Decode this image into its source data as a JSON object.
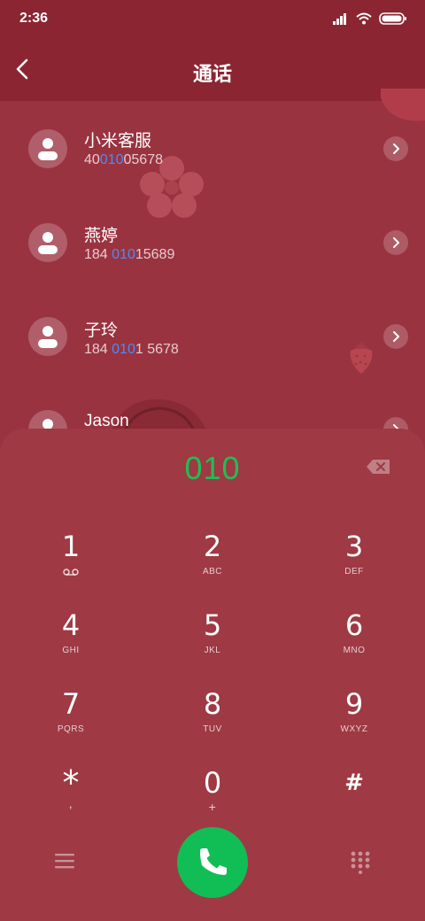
{
  "status": {
    "time": "2:36"
  },
  "header": {
    "title": "通话"
  },
  "contacts": [
    {
      "name": "小米客服",
      "num_pre": "40",
      "num_hl": "010",
      "num_post": "05678"
    },
    {
      "name": "燕婷",
      "num_pre": "184 ",
      "num_hl": "010",
      "num_post": "15689"
    },
    {
      "name": "子玲",
      "num_pre": "184 ",
      "num_hl": "010",
      "num_post": "1 5678"
    },
    {
      "name": "Jason",
      "num_pre": "",
      "num_hl": "",
      "num_post": ""
    }
  ],
  "dialer": {
    "input": "010",
    "keys": [
      {
        "digit": "1",
        "letters": "",
        "icon": "voicemail-icon"
      },
      {
        "digit": "2",
        "letters": "ABC"
      },
      {
        "digit": "3",
        "letters": "DEF"
      },
      {
        "digit": "4",
        "letters": "GHI"
      },
      {
        "digit": "5",
        "letters": "JKL"
      },
      {
        "digit": "6",
        "letters": "MNO"
      },
      {
        "digit": "7",
        "letters": "PQRS"
      },
      {
        "digit": "8",
        "letters": "TUV"
      },
      {
        "digit": "9",
        "letters": "WXYZ"
      },
      {
        "digit": "*",
        "letters": ","
      },
      {
        "digit": "0",
        "letters": "+"
      },
      {
        "digit": "#",
        "letters": ""
      }
    ]
  },
  "icons": {
    "back": "chevron-left-icon",
    "signal": "signal-icon",
    "wifi": "wifi-icon",
    "battery": "battery-icon",
    "backspace": "backspace-icon",
    "menu": "menu-icon",
    "call": "phone-icon",
    "keypad": "keypad-grid-icon"
  },
  "colors": {
    "background": "#9a3340",
    "header": "#8b2532",
    "dialed_digits": "#1fbf55",
    "match_highlight": "#4a8cf7",
    "call_button": "#11bd55"
  }
}
